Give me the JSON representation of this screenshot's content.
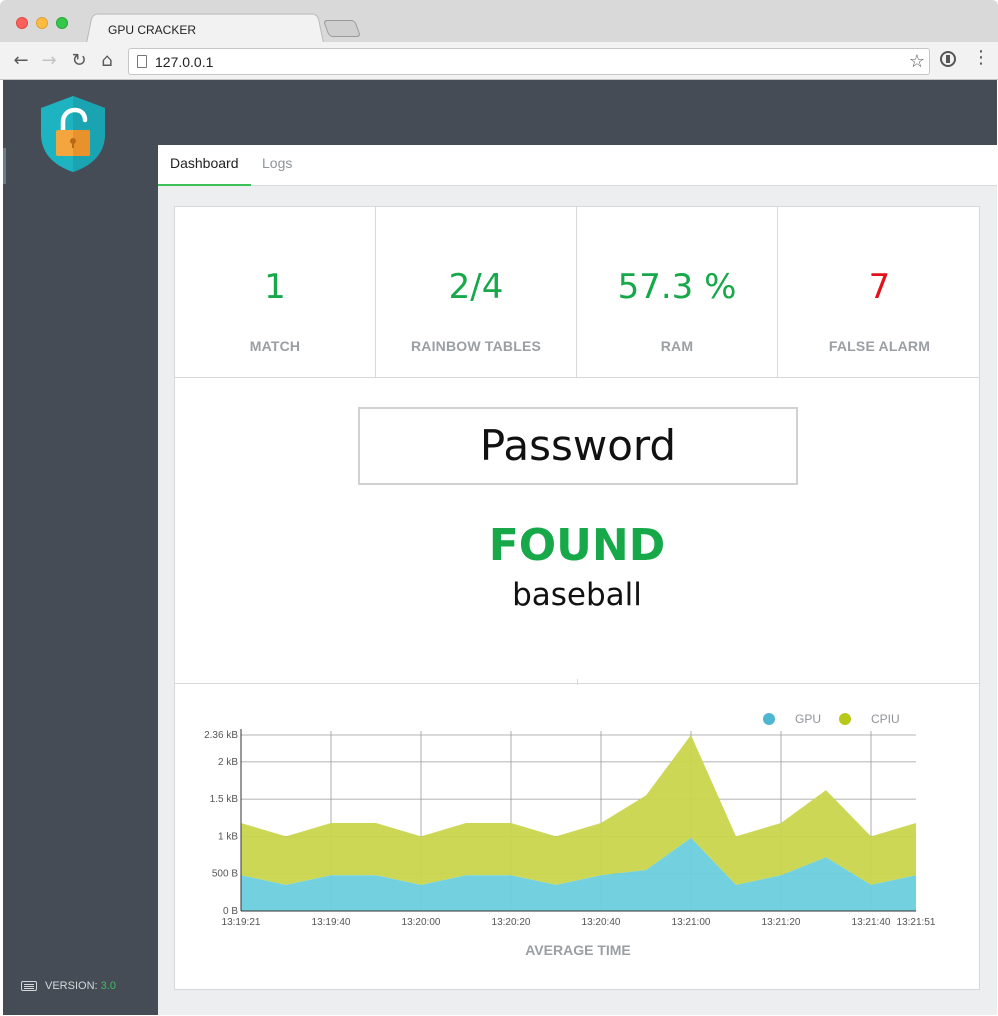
{
  "browser": {
    "tab_title": "GPU CRACKER",
    "url": "127.0.0.1",
    "icons": [
      "back-icon",
      "forward-icon",
      "reload-icon",
      "home-icon",
      "bookmark-star-icon",
      "extension-icon",
      "menu-icon"
    ]
  },
  "sidebar": {
    "logo_icon": "shield-unlocked-padlock-icon",
    "version_label": "VERSION:",
    "version_number": "3.0"
  },
  "nav": {
    "tabs": [
      {
        "label": "Dashboard",
        "active": true
      },
      {
        "label": "Logs",
        "active": false
      }
    ]
  },
  "stats": [
    {
      "value": "1",
      "label": "MATCH",
      "color": "#16a849"
    },
    {
      "value": "2/4",
      "label": "RAINBOW TABLES",
      "color": "#16a849"
    },
    {
      "value": "57.3 %",
      "label": "RAM",
      "color": "#16a849"
    },
    {
      "value": "7",
      "label": "FALSE ALARM",
      "color": "#e3121a"
    }
  ],
  "result": {
    "heading": "Password",
    "status": "FOUND",
    "word": "baseball"
  },
  "chart_data": {
    "type": "area",
    "xlabel": "AVERAGE TIME",
    "ylabel": "",
    "x_tick_labels": [
      "13:19:21",
      "13:19:40",
      "13:20:00",
      "13:20:20",
      "13:20:40",
      "13:21:00",
      "13:21:20",
      "13:21:40",
      "13:21:51"
    ],
    "x_tick_positions": [
      0,
      2,
      4,
      6,
      8,
      10,
      12,
      14,
      15
    ],
    "y_tick_labels": [
      "0 B",
      "500 B",
      "1 kB",
      "1.5 kB",
      "2 kB",
      "2.36 kB"
    ],
    "y_tick_values": [
      0,
      500,
      1000,
      1500,
      2000,
      2360
    ],
    "ylim": [
      0,
      2360
    ],
    "stacked": true,
    "grid": true,
    "legend_position": "top-right",
    "series": [
      {
        "name": "GPU",
        "color": "#6ccfdd",
        "legend_color": "#4fb6d2",
        "values": [
          480,
          350,
          480,
          480,
          350,
          480,
          480,
          350,
          480,
          550,
          980,
          350,
          480,
          720,
          350,
          480
        ]
      },
      {
        "name": "CPIU",
        "color": "#c9d64c",
        "legend_color": "#b9c91a",
        "values": [
          700,
          650,
          700,
          700,
          650,
          700,
          700,
          650,
          700,
          1000,
          1380,
          650,
          700,
          900,
          650,
          700
        ]
      }
    ]
  }
}
